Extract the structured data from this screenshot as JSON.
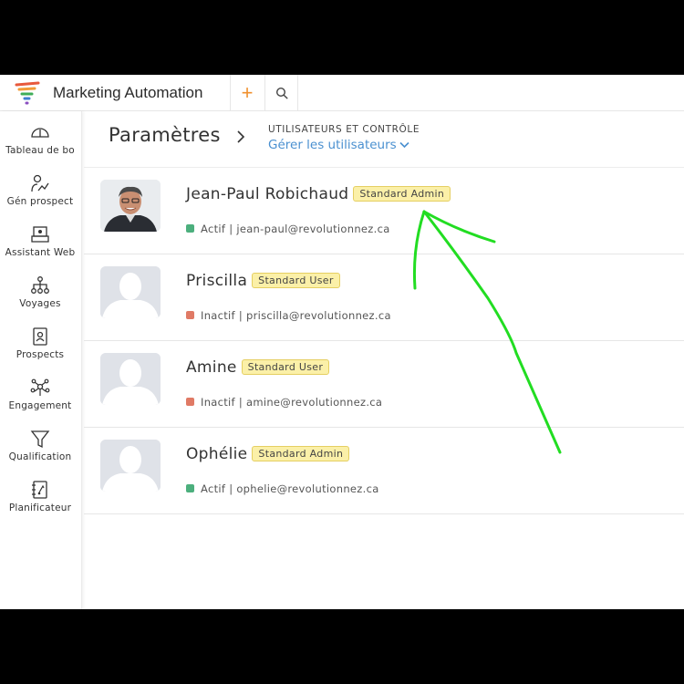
{
  "app": {
    "title": "Marketing Automation"
  },
  "toolbar": {
    "add_icon": "plus-icon",
    "search_icon": "search-icon"
  },
  "sidebar": {
    "items": [
      {
        "label": "Tableau de bo",
        "icon": "gauge-icon"
      },
      {
        "label": "Gén prospect",
        "icon": "person-chart-icon"
      },
      {
        "label": "Assistant Web",
        "icon": "web-assistant-icon"
      },
      {
        "label": "Voyages",
        "icon": "journey-tree-icon"
      },
      {
        "label": "Prospects",
        "icon": "contact-book-icon"
      },
      {
        "label": "Engagement",
        "icon": "engagement-icon"
      },
      {
        "label": "Qualification",
        "icon": "funnel-icon"
      },
      {
        "label": "Planificateur",
        "icon": "planner-icon"
      }
    ]
  },
  "header": {
    "title": "Paramètres",
    "breadcrumb_section": "UTILISATEURS ET CONTRÔLE",
    "breadcrumb_page": "Gérer les utilisateurs"
  },
  "users": [
    {
      "name": "Jean-Paul Robichaud",
      "role": "Standard Admin",
      "status": "Actif",
      "email": "jean-paul@revolutionnez.ca",
      "status_color": "#4caf7d",
      "has_photo": true
    },
    {
      "name": "Priscilla",
      "role": "Standard User",
      "status": "Inactif",
      "email": "priscilla@revolutionnez.ca",
      "status_color": "#e07a65",
      "has_photo": false
    },
    {
      "name": "Amine",
      "role": "Standard User",
      "status": "Inactif",
      "email": "amine@revolutionnez.ca",
      "status_color": "#e07a65",
      "has_photo": false
    },
    {
      "name": "Ophélie",
      "role": "Standard Admin",
      "status": "Actif",
      "email": "ophelie@revolutionnez.ca",
      "status_color": "#4caf7d",
      "has_photo": false
    }
  ],
  "colors": {
    "accent": "#f0912e",
    "link": "#4a90d0",
    "badge_bg": "#fbf0a8",
    "annotation": "#22dd22"
  }
}
